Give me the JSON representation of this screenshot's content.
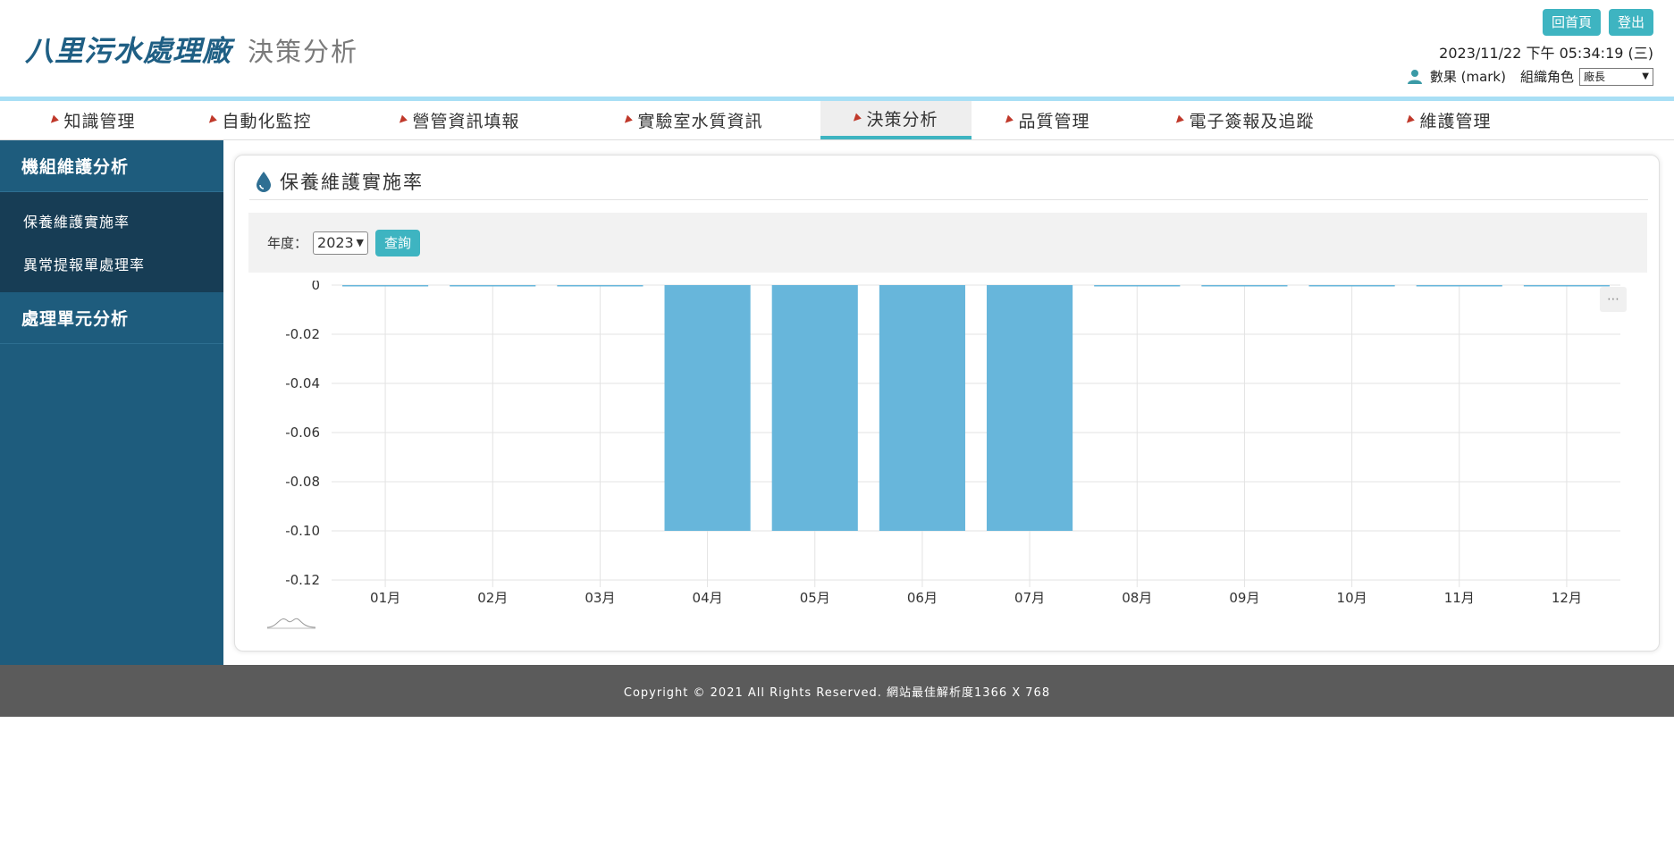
{
  "header": {
    "logo": "八里污水處理廠",
    "subtitle": "決策分析",
    "home_label": "回首頁",
    "logout_label": "登出",
    "datetime": "2023/11/22 下午 05:34:19 (三)",
    "user": "數果 (mark)",
    "role_label": "組織角色",
    "role_value": "廠長"
  },
  "nav": {
    "items": [
      {
        "label": "知識管理"
      },
      {
        "label": "自動化監控"
      },
      {
        "label": "營管資訊填報"
      },
      {
        "label": "實驗室水質資訊"
      },
      {
        "label": "決策分析"
      },
      {
        "label": "品質管理"
      },
      {
        "label": "電子簽報及追蹤"
      },
      {
        "label": "維護管理"
      }
    ],
    "active_index": 4
  },
  "sidebar": {
    "section1": "機組維護分析",
    "items": [
      {
        "label": "保養維護實施率"
      },
      {
        "label": "異常提報單處理率"
      }
    ],
    "section2": "處理單元分析"
  },
  "panel": {
    "title": "保養維護實施率",
    "year_label": "年度：",
    "year_value": "2023",
    "query_label": "查詢"
  },
  "chart_data": {
    "type": "bar",
    "categories": [
      "01月",
      "02月",
      "03月",
      "04月",
      "05月",
      "06月",
      "07月",
      "08月",
      "09月",
      "10月",
      "11月",
      "12月"
    ],
    "values": [
      0,
      0,
      0,
      -0.1,
      -0.1,
      -0.1,
      -0.1,
      0,
      0,
      0,
      0,
      0
    ],
    "yticks": [
      "0",
      "-0.02",
      "-0.04",
      "-0.06",
      "-0.08",
      "-0.10",
      "-0.12"
    ],
    "ylim": [
      -0.12,
      0
    ],
    "grid": true,
    "bar_color": "#67b6db"
  },
  "footer": {
    "text": "Copyright © 2021 All Rights Reserved. 網站最佳解析度1366 X 768"
  },
  "colors": {
    "accent": "#3eb4c1",
    "sidebar": "#1e5c7d",
    "sidebar_sub": "#173d55",
    "logo": "#1f5f84"
  }
}
